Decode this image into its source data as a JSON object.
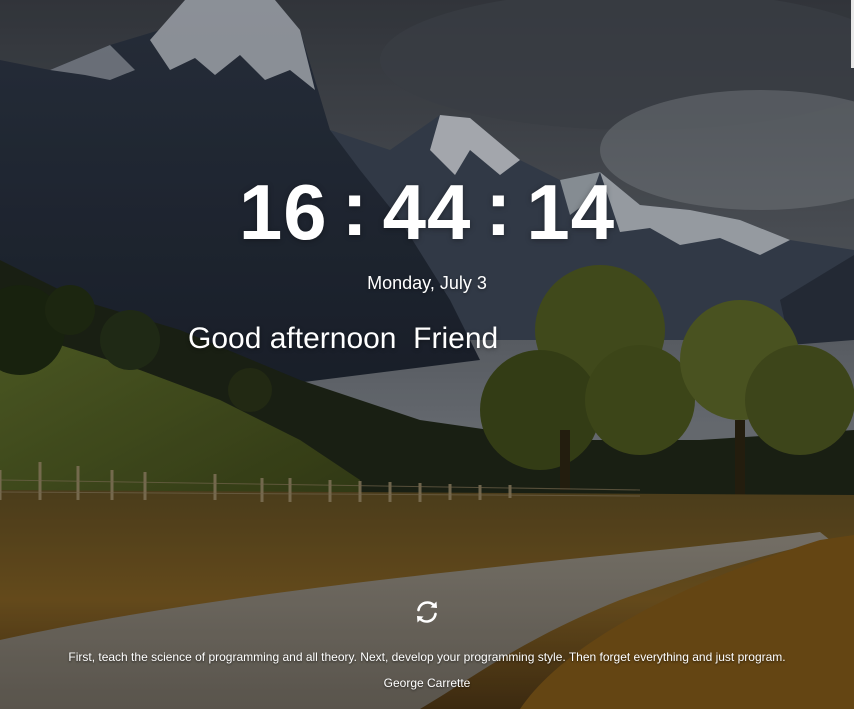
{
  "clock": {
    "hours": "16",
    "minutes": "44",
    "seconds": "14",
    "separator": ":"
  },
  "date": "Monday, July 3",
  "greeting": {
    "salutation": "Good afternoon",
    "name": "Friend"
  },
  "quote": {
    "text": "First, teach the science of programming and all theory. Next, develop your programming style. Then forget everything and just program.",
    "author": "George Carrette"
  },
  "icons": {
    "refresh": "refresh-icon"
  },
  "colors": {
    "text": "#ffffff",
    "sky": "#4a5059",
    "field": "#8a6a2a"
  }
}
